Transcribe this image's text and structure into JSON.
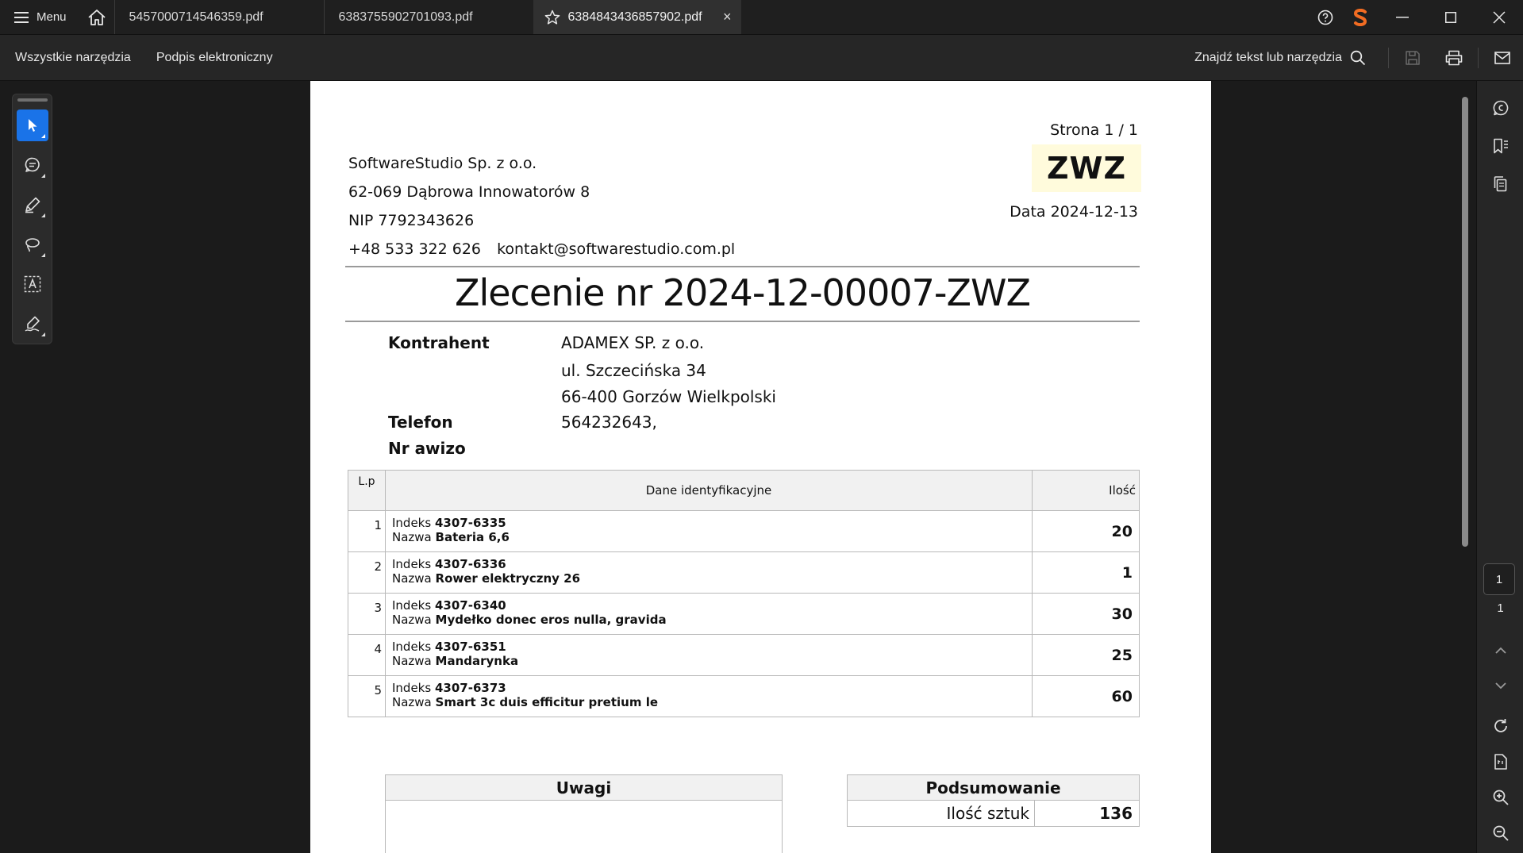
{
  "titlebar": {
    "menu_label": "Menu",
    "tabs": [
      {
        "label": "5457000714546359.pdf"
      },
      {
        "label": "6383755902701093.pdf"
      },
      {
        "label": "6384843436857902.pdf",
        "active": true
      }
    ],
    "close_glyph": "×"
  },
  "toolbar": {
    "all_tools": "Wszystkie narzędzia",
    "esign": "Podpis elektroniczny",
    "find_label": "Znajdź tekst lub narzędzia"
  },
  "document": {
    "company": {
      "name": "SoftwareStudio Sp. z o.o.",
      "address": "62-069 Dąbrowa Innowatorów 8",
      "nip": "NIP 7792343626",
      "phone": "+48 533 322 626",
      "email": "kontakt@softwarestudio.com.pl"
    },
    "page_label": "Strona 1 / 1",
    "doc_type": "ZWZ",
    "date_label": "Data 2024-12-13",
    "title": "Zlecenie nr 2024-12-00007-ZWZ",
    "contractor_label": "Kontrahent",
    "contractor_name": "ADAMEX SP. z o.o.",
    "contractor_street": "ul. Szczecińska 34",
    "contractor_city": "66-400 Gorzów Wielkpolski",
    "phone_label": "Telefon",
    "phone_value": "564232643,",
    "awizo_label": "Nr awizo",
    "table": {
      "col_lp": "L.p",
      "col_desc": "Dane identyfikacyjne",
      "col_qty": "Ilość",
      "index_label": "Indeks",
      "name_label": "Nazwa",
      "rows": [
        {
          "lp": "1",
          "index": "4307-6335",
          "name": "Bateria 6,6",
          "qty": "20"
        },
        {
          "lp": "2",
          "index": "4307-6336",
          "name": "Rower elektryczny 26",
          "qty": "1"
        },
        {
          "lp": "3",
          "index": "4307-6340",
          "name": "Mydełko donec eros nulla, gravida",
          "qty": "30"
        },
        {
          "lp": "4",
          "index": "4307-6351",
          "name": "Mandarynka",
          "qty": "25"
        },
        {
          "lp": "5",
          "index": "4307-6373",
          "name": "Smart 3c duis efficitur pretium le",
          "qty": "60"
        }
      ]
    },
    "remarks_label": "Uwagi",
    "summary_label": "Podsumowanie",
    "summary_qty_label": "Ilość sztuk",
    "summary_qty_value": "136"
  },
  "pager": {
    "current": "1",
    "total": "1"
  },
  "colors": {
    "accent": "#1a73e8",
    "brand_orange": "#f26c22",
    "zwz_highlight": "#fffbdc"
  },
  "icons": {
    "titlebar": [
      "hamburger-icon",
      "home-icon",
      "star-icon",
      "help-icon",
      "brand-logo-icon",
      "minimize-icon",
      "maximize-icon",
      "window-close-icon"
    ],
    "toolbar": [
      "search-icon",
      "save-icon",
      "print-icon",
      "mail-icon"
    ],
    "left_tools": [
      "select-cursor-icon",
      "comment-icon",
      "highlight-pen-icon",
      "lasso-draw-icon",
      "text-box-icon",
      "sign-icon"
    ],
    "right_rail": [
      "ai-assistant-icon",
      "bookmark-icon",
      "copy-pages-icon",
      "chevron-up-icon",
      "chevron-down-icon",
      "rotate-icon",
      "page-fit-icon",
      "zoom-in-icon",
      "zoom-out-icon"
    ]
  }
}
